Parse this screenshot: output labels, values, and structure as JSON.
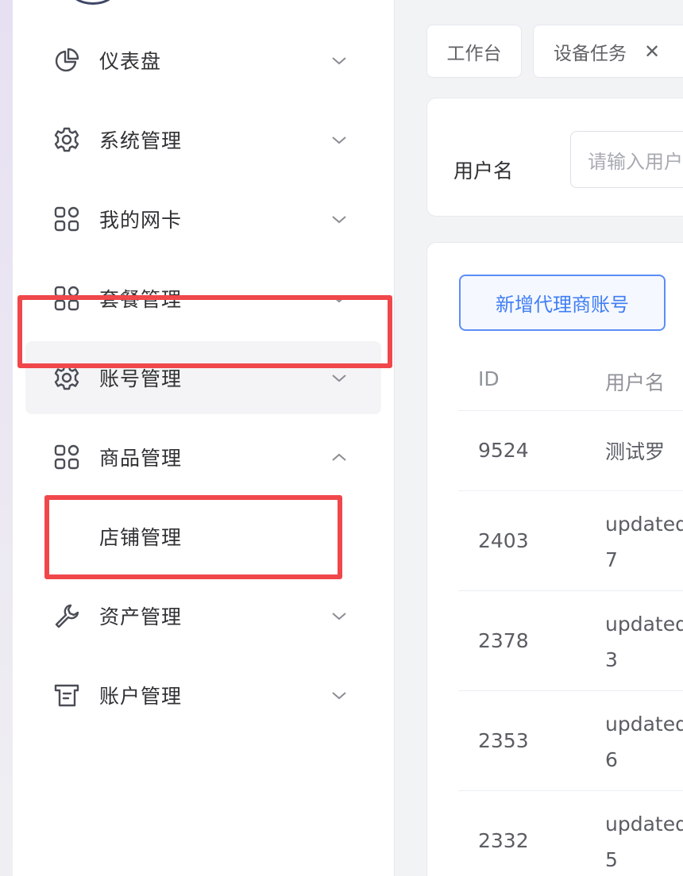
{
  "sidebar": {
    "items": [
      {
        "label": "仪表盘",
        "icon": "pie-chart-icon",
        "expanded": false
      },
      {
        "label": "系统管理",
        "icon": "gear-icon",
        "expanded": false
      },
      {
        "label": "我的网卡",
        "icon": "grid-icon",
        "expanded": false
      },
      {
        "label": "套餐管理",
        "icon": "grid-icon",
        "expanded": false
      },
      {
        "label": "账号管理",
        "icon": "gear-icon",
        "expanded": false,
        "active": true
      },
      {
        "label": "商品管理",
        "icon": "grid-icon",
        "expanded": true
      },
      {
        "label": "资产管理",
        "icon": "wrench-icon",
        "expanded": false
      },
      {
        "label": "账户管理",
        "icon": "document-icon",
        "expanded": false
      }
    ],
    "submenu": {
      "label": "店铺管理"
    }
  },
  "tabs": [
    {
      "label": "工作台"
    },
    {
      "label": "设备任务",
      "closable": true
    }
  ],
  "filter": {
    "username_label": "用户名",
    "username_placeholder": "请输入用户名"
  },
  "actions": {
    "add_agent_label": "新增代理商账号"
  },
  "table": {
    "headers": [
      "ID",
      "用户名"
    ],
    "rows": [
      {
        "id": "9524",
        "user": [
          "测试罗"
        ]
      },
      {
        "id": "2403",
        "user": [
          "updated",
          "7"
        ]
      },
      {
        "id": "2378",
        "user": [
          "updated",
          "3"
        ]
      },
      {
        "id": "2353",
        "user": [
          "updated",
          "6"
        ]
      },
      {
        "id": "2332",
        "user": [
          "updated",
          "5"
        ]
      }
    ]
  },
  "colors": {
    "highlight": "#f0474b",
    "primary": "#3f7ef4",
    "active_bg": "#f4f4f6"
  }
}
